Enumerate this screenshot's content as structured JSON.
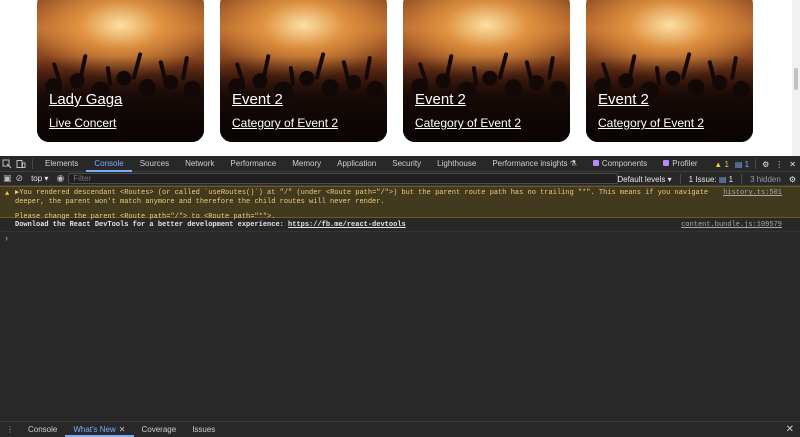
{
  "cards": [
    {
      "title": "Lady Gaga",
      "subtitle": "Live Concert"
    },
    {
      "title": "Event 2",
      "subtitle": "Category of Event 2"
    },
    {
      "title": "Event 2",
      "subtitle": "Category of Event 2"
    },
    {
      "title": "Event 2",
      "subtitle": "Category of Event 2"
    }
  ],
  "devtools": {
    "tabs": [
      "Elements",
      "Console",
      "Sources",
      "Network",
      "Performance",
      "Memory",
      "Application",
      "Security",
      "Lighthouse",
      "Performance insights",
      "Components",
      "Profiler"
    ],
    "active_tab": "Console",
    "warning_count": "1",
    "info_count": "1",
    "context": "top",
    "filter_placeholder": "Filter",
    "levels": "Default levels",
    "issues": "1 Issue:",
    "issues_count": "1",
    "hidden": "3 hidden",
    "warning_text_1": "▶You rendered descendant <Routes> (or called `useRoutes()`) at \"/\" (under <Route path=\"/\">) but the parent route path has no trailing \"*\". This means if you navigate deeper, the parent won't match anymore and therefore the child routes will never render.",
    "warning_text_2": "Please change the parent <Route path=\"/\"> to <Route path=\"*\">.",
    "warning_source": "history.ts:501",
    "log_text": "Download the React DevTools for a better development experience: ",
    "log_link": "https://fb.me/react-devtools",
    "log_source": "content.bundle.js:109579",
    "prompt": "›",
    "drawer_tabs": [
      "Console",
      "What's New",
      "Coverage",
      "Issues"
    ],
    "drawer_active": "What's New"
  }
}
